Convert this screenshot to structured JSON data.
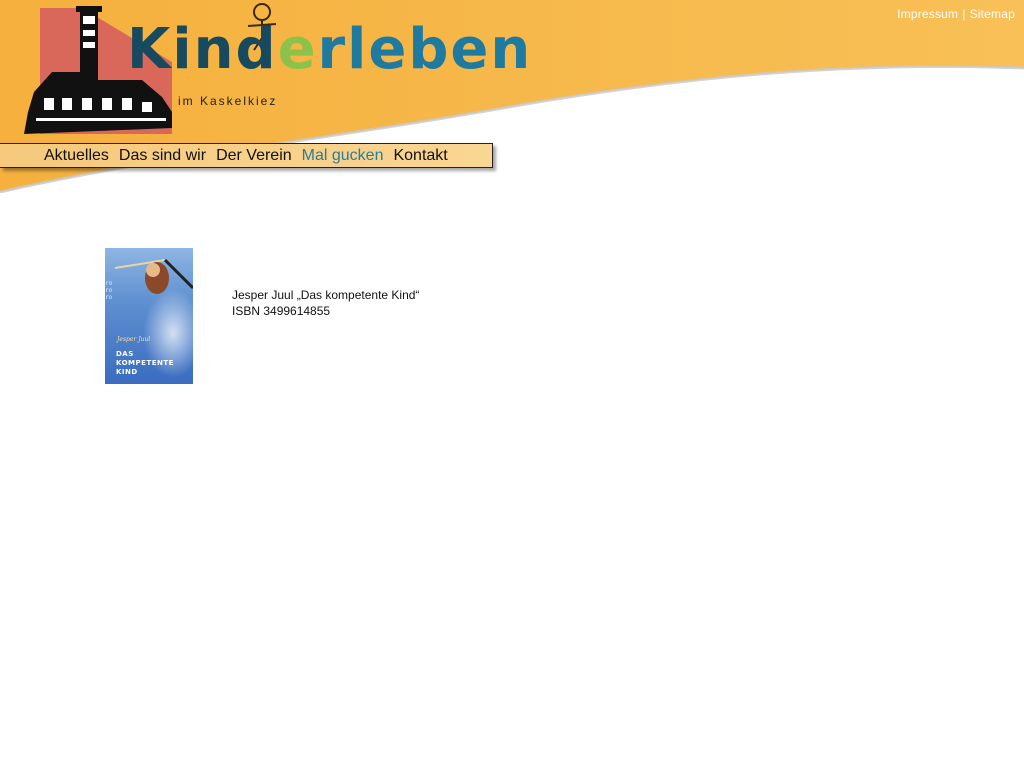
{
  "top_links": {
    "impressum": "Impressum",
    "separator": "|",
    "sitemap": "Sitemap"
  },
  "logo": {
    "word_part1": "Kin",
    "word_part2": "d",
    "word_part3": "e",
    "word_part4": "rleben",
    "subtitle": "im Kaskelkiez",
    "icon": "lighthouse-logo-icon"
  },
  "nav": {
    "items": [
      {
        "label": "Aktuelles",
        "active": false
      },
      {
        "label": "Das sind wir",
        "active": false
      },
      {
        "label": "Der Verein",
        "active": false
      },
      {
        "label": "Mal gucken",
        "active": true
      },
      {
        "label": "Kontakt",
        "active": false
      }
    ]
  },
  "book": {
    "cover_author": "Jesper Juul",
    "cover_title": "DAS\nKOMPETENTE\nKIND",
    "cover_spine": "ro\nro\nro",
    "line1": "Jesper Juul „Das kompetente Kind“",
    "line2": "ISBN 3499614855"
  },
  "colors": {
    "header_orange": "#f6b84a",
    "nav_bg": "#f8d08a",
    "active_nav": "#2a7c99",
    "logo_blue": "#1f6a8c",
    "logo_green": "#8bc34a"
  }
}
